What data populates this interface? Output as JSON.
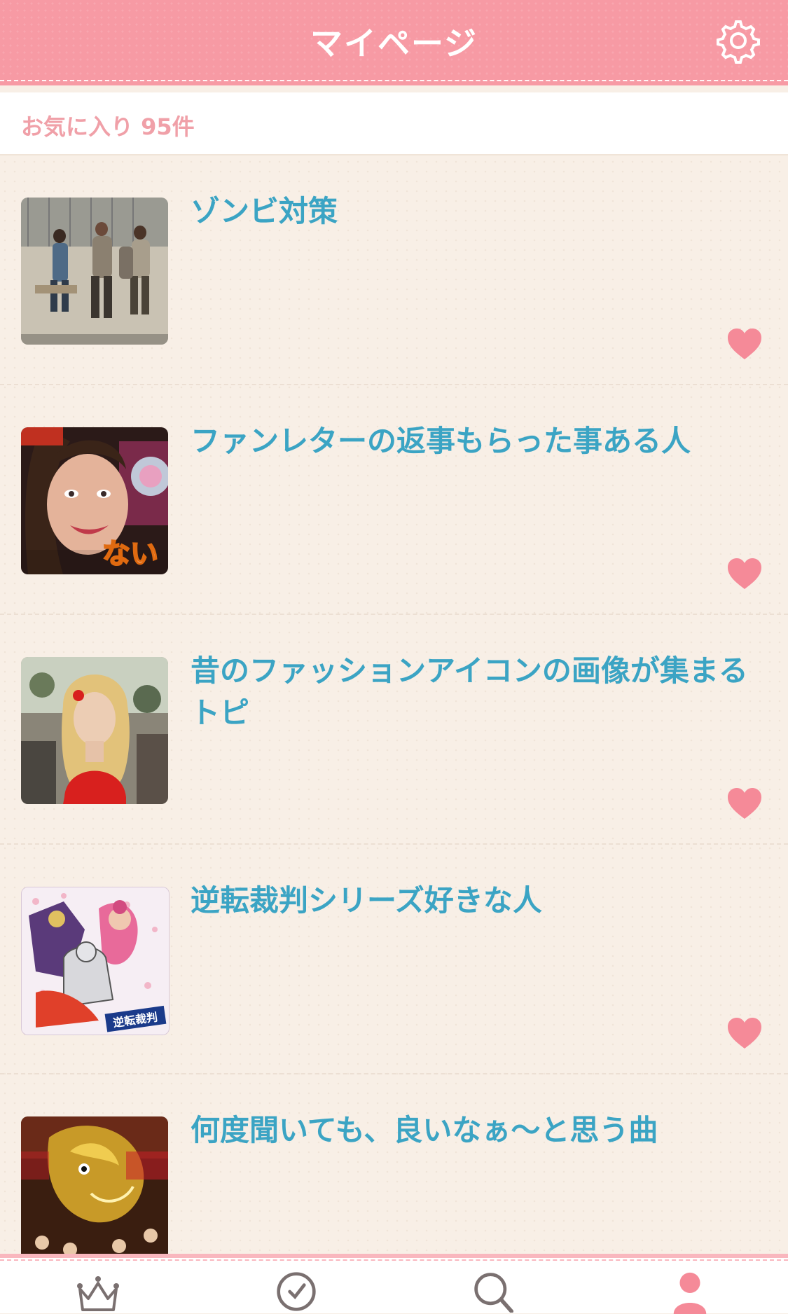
{
  "header": {
    "title": "マイページ",
    "settings_icon": "gear-icon"
  },
  "favorites": {
    "count_label": "お気に入り 95件"
  },
  "items": [
    {
      "title": "ゾンビ対策",
      "thumbnail": "zombie-scene-photo"
    },
    {
      "title": "ファンレターの返事もらった事ある人",
      "thumbnail": "smiling-woman-tv-screenshot",
      "thumbnail_caption": "ない"
    },
    {
      "title": "昔のファッションアイコンの画像が集まるトピ",
      "thumbnail": "blonde-woman-red-dress-photo"
    },
    {
      "title": "逆転裁判シリーズ好きな人",
      "thumbnail": "anime-game-illustration",
      "thumbnail_caption": "逆転裁判"
    },
    {
      "title": "何度聞いても、良いなぁ〜と思う曲",
      "thumbnail": "golden-dragon-festival-photo"
    }
  ],
  "tabbar": {
    "tabs": [
      {
        "icon": "crown-icon"
      },
      {
        "icon": "clock-icon"
      },
      {
        "icon": "search-icon"
      },
      {
        "icon": "user-icon",
        "active": true
      }
    ]
  },
  "colors": {
    "header": "#f79aa4",
    "title_text": "#3ba4c4",
    "heart": "#f58a98",
    "count_text": "#f0a0a8"
  }
}
